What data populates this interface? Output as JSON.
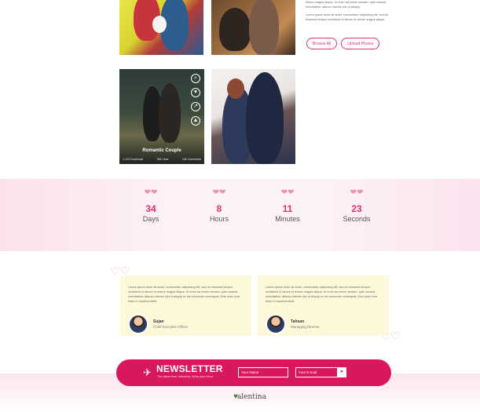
{
  "gallery": {
    "side_text": [
      "dolore magna aliqua. Ut enim ad minim veniam, quis nostrud exercitation ullamco laboris nisi ut aliquip.",
      "Lorem ipsum dolor sit amet, consectetur adipiscing elit, sed do eiusmod tempor incididunt ut labore et dolore magna aliqua."
    ],
    "browse_label": "Browse All",
    "upload_label": "Upload Photos",
    "featured": {
      "title": "Romantic Couple",
      "downloads": "1,120 Download",
      "likes": "786 Likes",
      "comments": "13k Comments"
    }
  },
  "countdown": [
    {
      "value": "34",
      "label": "Days"
    },
    {
      "value": "8",
      "label": "Hours"
    },
    {
      "value": "11",
      "label": "Minutes"
    },
    {
      "value": "23",
      "label": "Seconds"
    }
  ],
  "testimonials": [
    {
      "text": "Lorem ipsum dolor sit amet, consectetur adipiscing elit, sed do eiusmod tempor incididunt ut labore et dolore magna aliqua. Ut enim ad minim veniam, quis nostrud exercitation ullamco laboris nisi ut aliquip ex ea commodo consequat. Duis aute irure dolor in reprehenderit.",
      "name": "Sujan",
      "role": "Chief Exicutive Officer"
    },
    {
      "text": "Lorem ipsum dolor sit amet, consectetur adipiscing elit, sed do eiusmod tempor incididunt ut labore et dolore magna aliqua. Ut enim ad minim veniam, quis nostrud exercitation ullamco laboris nisi ut aliquip ex ea commodo consequat. Duis aute irure dolor in reprehenderit.",
      "name": "Tahsan",
      "role": "Managing Director"
    }
  ],
  "newsletter": {
    "title": "NEWSLETTER",
    "subtitle": "The latest from Valentina, Write your inbox",
    "name_placeholder": "Your Name",
    "email_placeholder": "Your E-mail"
  },
  "logo_text": "alentina",
  "colors": {
    "accent": "#d9175c",
    "heart": "#f28db0"
  }
}
